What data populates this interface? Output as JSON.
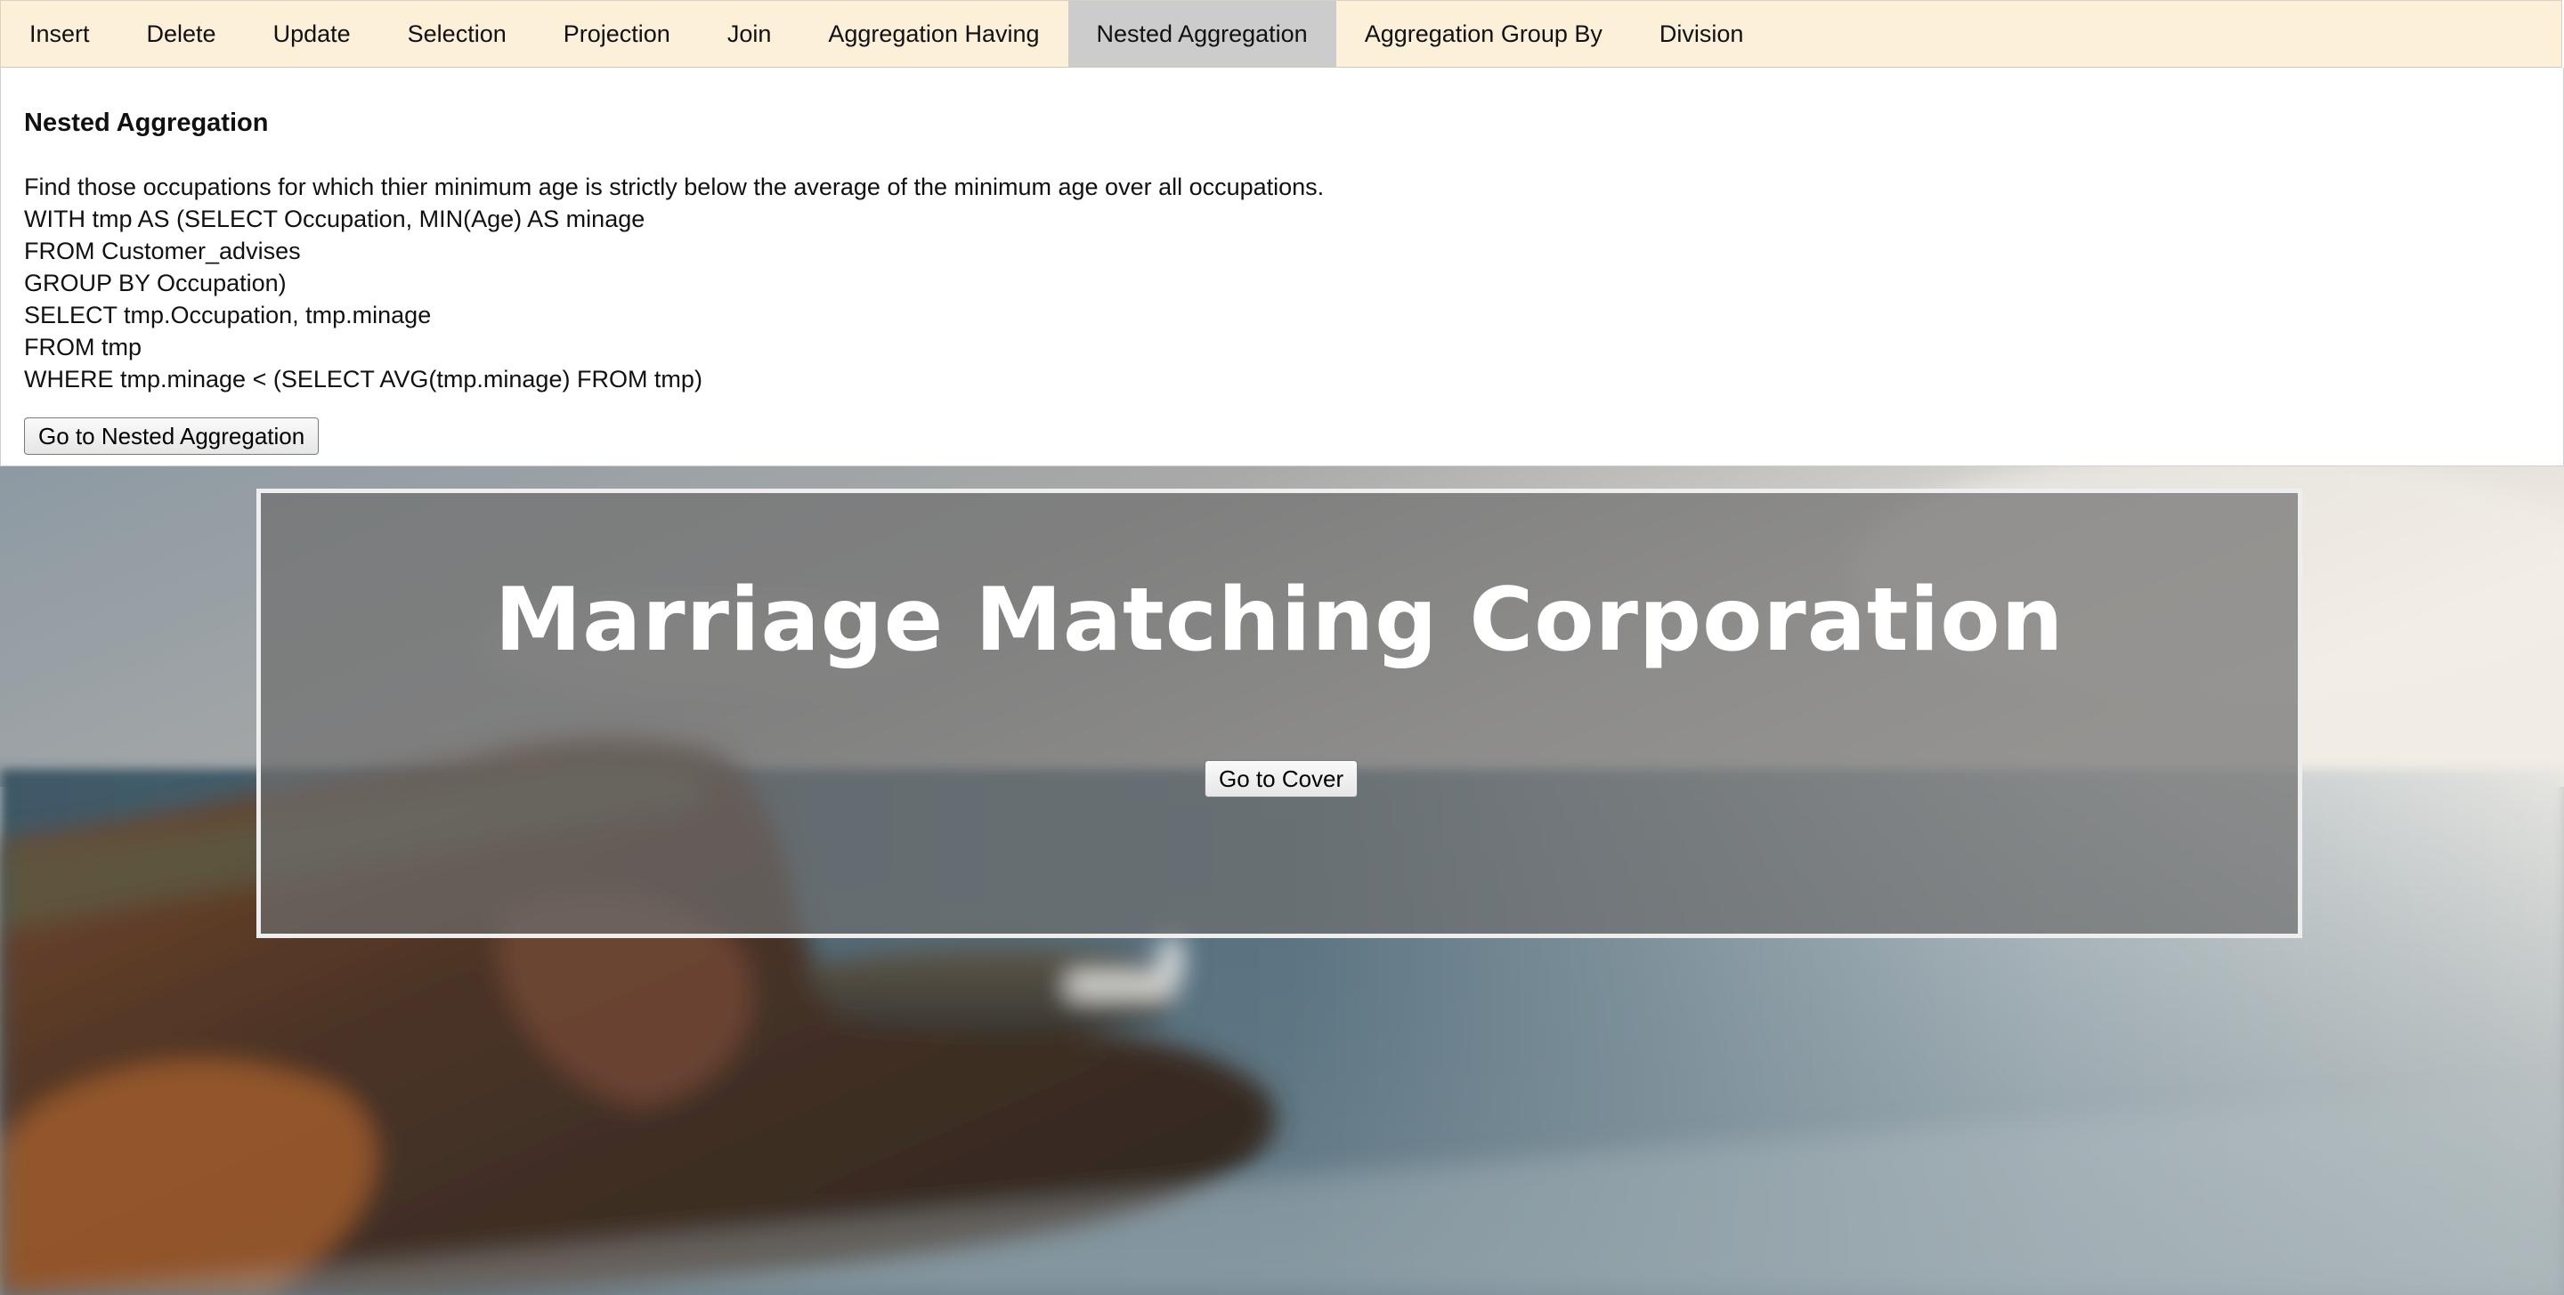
{
  "tabs": [
    {
      "label": "Insert",
      "active": false
    },
    {
      "label": "Delete",
      "active": false
    },
    {
      "label": "Update",
      "active": false
    },
    {
      "label": "Selection",
      "active": false
    },
    {
      "label": "Projection",
      "active": false
    },
    {
      "label": "Join",
      "active": false
    },
    {
      "label": "Aggregation Having",
      "active": false
    },
    {
      "label": "Nested Aggregation",
      "active": true
    },
    {
      "label": "Aggregation Group By",
      "active": false
    },
    {
      "label": "Division",
      "active": false
    }
  ],
  "panel": {
    "title": "Nested Aggregation",
    "description": "Find those occupations for which thier minimum age is strictly below the average of the minimum age over all occupations.",
    "sql_lines": [
      "WITH tmp AS (SELECT Occupation, MIN(Age) AS minage",
      "FROM Customer_advises",
      "GROUP BY Occupation)",
      "SELECT tmp.Occupation, tmp.minage",
      "FROM tmp",
      "WHERE tmp.minage < (SELECT AVG(tmp.minage) FROM tmp)"
    ],
    "button_label": "Go to Nested Aggregation"
  },
  "banner": {
    "title": "Marriage Matching Corporation",
    "button_label": "Go to Cover"
  },
  "colors": {
    "tabbar_bg": "#fcf0d9",
    "active_tab_bg": "#cccccc",
    "banner_overlay": "#6e6e6e",
    "banner_text": "#ffffff"
  }
}
